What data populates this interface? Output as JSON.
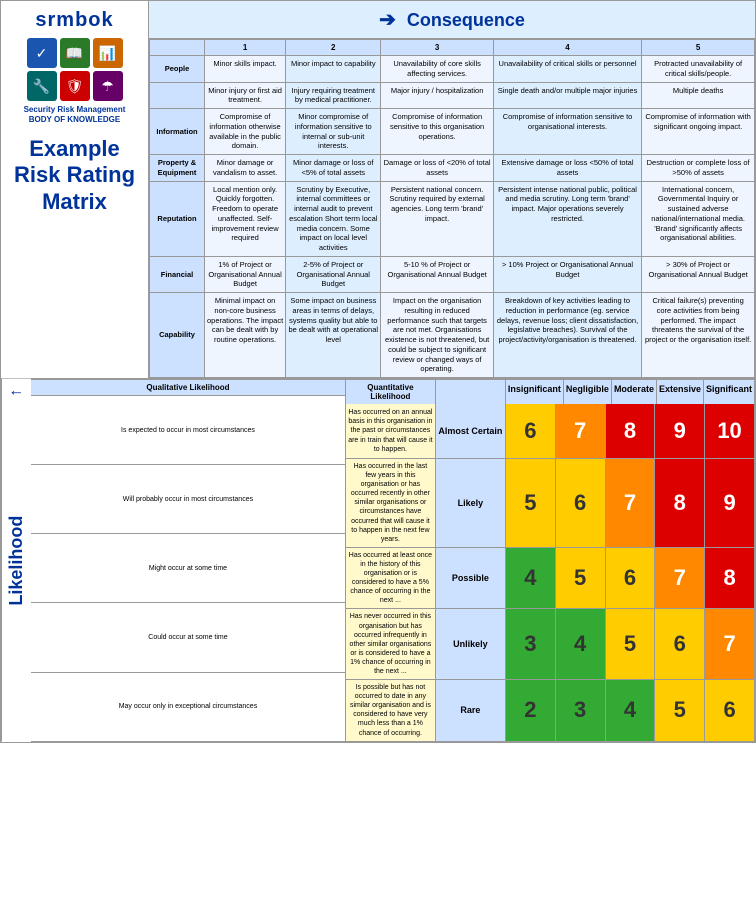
{
  "logo": {
    "name": "srmbok",
    "subtitle": "Security Risk Management\nBODY OF KNOWLEDGE"
  },
  "title": {
    "line1": "Example",
    "line2": "Risk Rating",
    "line3": "Matrix"
  },
  "consequence": {
    "header": "Consequence",
    "columns": [
      "",
      "1",
      "2",
      "3",
      "4",
      "5"
    ],
    "col_labels": [
      "",
      "Insignificant",
      "Negligible",
      "Moderate",
      "Extensive",
      "Significant"
    ],
    "rows": [
      {
        "header": "People",
        "cells": [
          "Minor skills impact.",
          "Minor impact to capability",
          "Unavailability of core skills affecting services.",
          "Unavailability of critical skills or personnel",
          "Protracted unavailability of critical skills/people."
        ]
      },
      {
        "header": "",
        "cells": [
          "Minor injury or first aid treatment.",
          "Injury requiring treatment by medical practitioner.",
          "Major injury / hospitalization",
          "Single death and/or multiple major injuries",
          "Multiple deaths"
        ]
      },
      {
        "header": "Information",
        "cells": [
          "Compromise of information otherwise available in the public domain.",
          "Minor compromise of information sensitive to internal or sub-unit interests.",
          "Compromise of information sensitive to this organisation operations.",
          "Compromise of information sensitive to organisational interests.",
          "Compromise of information with significant ongoing impact."
        ]
      },
      {
        "header": "Property & Equipment",
        "cells": [
          "Minor damage or vandalism to asset.",
          "Minor damage or loss of <5% of total assets",
          "Damage or loss of <20% of total assets",
          "Extensive damage or loss <50% of total assets",
          "Destruction or complete loss of >50% of assets"
        ]
      },
      {
        "header": "Reputation",
        "cells": [
          "Local mention only. Quickly forgotten. Freedom to operate unaffected. Self-improvement review required",
          "Scrutiny by Executive, internal committees or internal audit to prevent escalation Short term local media concern. Some impact on local level activities",
          "Persistent national concern. Scrutiny required by external agencies. Long term 'brand' impact.",
          "Persistent intense national public, political and media scrutiny. Long term 'brand' impact. Major operations severely restricted.",
          "International concern, Governmental Inquiry or sustained adverse national/international media. 'Brand' significantly affects organisational abilities."
        ]
      },
      {
        "header": "Financial",
        "cells": [
          "1% of Project or Organisational Annual Budget",
          "2-5% of Project or Organisational Annual Budget",
          "5-10 % of Project or Organisational Annual Budget",
          "> 10% Project or Organisational Annual Budget",
          "> 30% of Project or Organisational Annual Budget"
        ]
      },
      {
        "header": "Capability",
        "cells": [
          "Minimal impact on non-core business operations. The impact can be dealt with by routine operations.",
          "Some impact on business areas in terms of delays, systems quality but able to be dealt with at operational level",
          "Impact on the organisation resulting in reduced performance such that targets are not met. Organisations existence is not threatened, but could be subject to significant review or changed ways of operating.",
          "Breakdown of key activities leading to reduction in performance (eg. service delays, revenue loss; client dissatisfaction, legislative breaches). Survival of the project/activity/organisation is threatened.",
          "Critical failure(s) preventing core activities from being performed. The impact threatens the survival of the project or the organisation itself."
        ]
      }
    ]
  },
  "likelihood": {
    "label": "Likelihood",
    "qual_header": "Qualitative Likelihood",
    "quant_header": "Quantitative Likelihood",
    "rows": [
      {
        "qualitative": "Is expected to occur in most circumstances",
        "quantitative": "Has occurred on an annual basis in this organisation in the past or circumstances are in train that will cause it to happen.",
        "name": "Almost Certain",
        "values": [
          6,
          7,
          8,
          9,
          10
        ],
        "colors": [
          "bg-yellow",
          "bg-orange",
          "bg-red",
          "bg-red",
          "bg-red"
        ]
      },
      {
        "qualitative": "Will probably occur in most circumstances",
        "quantitative": "Has occurred in the last few years in this organisation or has occurred recently in other similar organisations or circumstances have occurred that will cause it to happen in the next few years.",
        "name": "Likely",
        "values": [
          5,
          6,
          7,
          8,
          9
        ],
        "colors": [
          "bg-yellow",
          "bg-yellow",
          "bg-orange",
          "bg-red",
          "bg-red"
        ]
      },
      {
        "qualitative": "Might occur at some time",
        "quantitative": "Has occurred at least once in the history of this organisation or is considered to have a 5% chance of occurring in the next ...",
        "name": "Possible",
        "values": [
          4,
          5,
          6,
          7,
          8
        ],
        "colors": [
          "bg-green",
          "bg-yellow",
          "bg-yellow",
          "bg-orange",
          "bg-red"
        ]
      },
      {
        "qualitative": "Could occur at some time",
        "quantitative": "Has never occurred in this organisation but has occurred infrequently in other similar organisations or is considered to have a 1% chance of occurring in the next ...",
        "name": "Unlikely",
        "values": [
          3,
          4,
          5,
          6,
          7
        ],
        "colors": [
          "bg-green",
          "bg-green",
          "bg-yellow",
          "bg-yellow",
          "bg-orange"
        ]
      },
      {
        "qualitative": "May occur only in exceptional circumstances",
        "quantitative": "Is possible but has not occurred to date in any similar organisation and is considered to have very much less than a 1% chance of occurring.",
        "name": "Rare",
        "values": [
          2,
          3,
          4,
          5,
          6
        ],
        "colors": [
          "bg-green",
          "bg-green",
          "bg-green",
          "bg-yellow",
          "bg-yellow"
        ]
      }
    ]
  }
}
